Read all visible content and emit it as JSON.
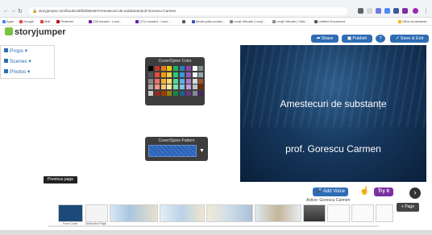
{
  "browser": {
    "url": "storyjumper.com/bookcraft/83066457/Amestecuri-de-substante/prof-Gorescu-Carmen",
    "bookmarks": [
      "Apps",
      "Google",
      "Mail",
      "Pinterest",
      "(23) kanzlei - Leon...",
      "(27) Leonard - Leon...",
      "",
      "Model pala corolla...",
      "Lecţii Virtuale | Lecţi...",
      "Lecţii Virtuale | Clas...",
      "Untitled Document",
      "Other bookmarks"
    ]
  },
  "app": {
    "logo": "storyjumper",
    "buttons": {
      "share": "Share",
      "publish": "Publish",
      "help": "?",
      "save_exit": "Save & Exit"
    }
  },
  "menu": {
    "items": [
      {
        "label": "Props"
      },
      {
        "label": "Scenes"
      },
      {
        "label": "Photos"
      }
    ]
  },
  "color_panel": {
    "title": "Cover/Spine Color",
    "swatches": [
      "#000000",
      "#c0392b",
      "#e67e22",
      "#f1c40f",
      "#27ae60",
      "#2980b9",
      "#8e44ad",
      "#ffffff",
      "#7f8c8d",
      "#555555",
      "#e74c3c",
      "#f39c12",
      "#f4d03f",
      "#2ecc71",
      "#3498db",
      "#9b59b6",
      "#ecf0f1",
      "#95a5a6",
      "#888888",
      "#ec7063",
      "#f5b041",
      "#f7dc6f",
      "#58d68d",
      "#5dade2",
      "#af7ac5",
      "#d5dbdb",
      "#a0522d",
      "#aaaaaa",
      "#f1948a",
      "#f8c471",
      "#f9e79f",
      "#82e0aa",
      "#85c1e9",
      "#c39bd3",
      "#bdc3c7",
      "#6e2c00",
      "#cccccc",
      "#922b21",
      "#a04000",
      "#9a7d0a",
      "#1d8348",
      "#1f618d",
      "#6c3483",
      "#808b96",
      "#4a235a"
    ]
  },
  "pattern_panel": {
    "title": "Cover/Spine Pattern"
  },
  "cover": {
    "title": "Amestecuri de substanțe",
    "author": "prof. Gorescu Carmen"
  },
  "tooltip": "Previous page",
  "voice": {
    "add_voice": "Add Voice",
    "try_it": "Try it",
    "active": "Active: Gorescu Carmen"
  },
  "pages": {
    "thumbs": [
      "Front Cover",
      "Dedication Page",
      "",
      "",
      "",
      "",
      "",
      "",
      "",
      "",
      "",
      ""
    ],
    "add_page": "Page"
  }
}
